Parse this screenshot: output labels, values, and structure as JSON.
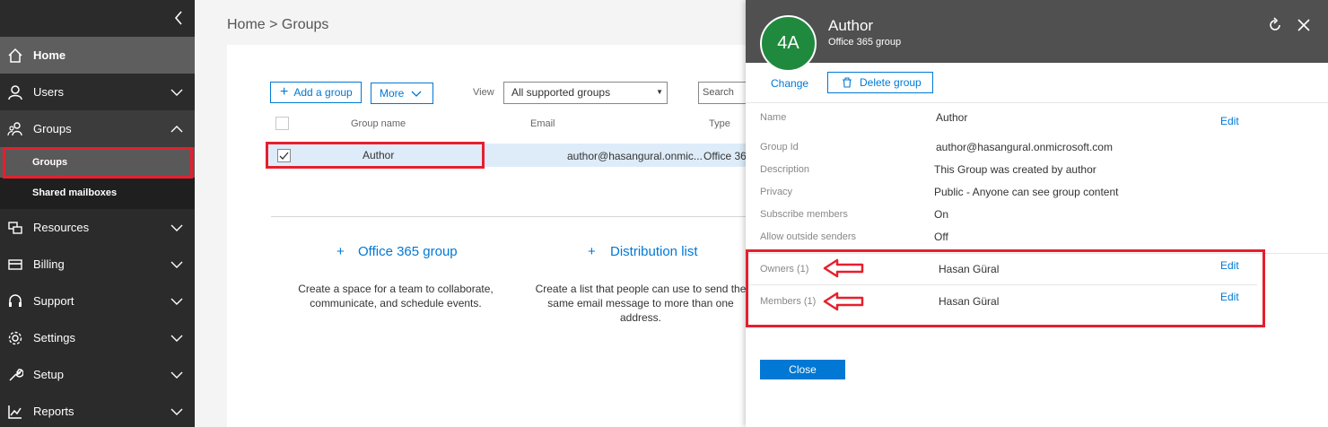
{
  "sidebar": {
    "items": [
      {
        "label": "Home",
        "icon": "home-icon"
      },
      {
        "label": "Users",
        "icon": "user-icon"
      },
      {
        "label": "Groups",
        "icon": "groups-icon"
      },
      {
        "label": "Resources",
        "icon": "resources-icon"
      },
      {
        "label": "Billing",
        "icon": "billing-icon"
      },
      {
        "label": "Support",
        "icon": "headset-icon"
      },
      {
        "label": "Settings",
        "icon": "gear-icon"
      },
      {
        "label": "Setup",
        "icon": "wrench-icon"
      },
      {
        "label": "Reports",
        "icon": "reports-icon"
      }
    ],
    "sub_items": [
      "Groups",
      "Shared mailboxes"
    ]
  },
  "breadcrumb": "Home > Groups",
  "toolbar": {
    "add_group": "Add a group",
    "more": "More",
    "view_label": "View",
    "view_value": "All supported groups",
    "search_placeholder": "Search"
  },
  "table": {
    "headers": [
      "Group name",
      "Email",
      "Type"
    ],
    "rows": [
      {
        "name": "Author",
        "email": "author@hasangural.onmic...",
        "type": "Office 36"
      }
    ]
  },
  "create_options": [
    {
      "title": "Office 365 group",
      "desc_lines": [
        "Create a space for a team to collaborate,",
        "communicate, and schedule events."
      ]
    },
    {
      "title": "Distribution list",
      "desc_lines": [
        "Create a list that people can use to send the",
        "same email message to more than one",
        "address."
      ]
    }
  ],
  "panel": {
    "avatar": "4A",
    "title": "Author",
    "subtitle": "Office 365 group",
    "change": "Change",
    "delete": "Delete group",
    "fields": [
      {
        "label": "Name",
        "value": "Author"
      },
      {
        "label": "Group Id",
        "value": "author@hasangural.onmicrosoft.com"
      },
      {
        "label": "Description",
        "value": "This Group was created by author"
      },
      {
        "label": "Privacy",
        "value": "Public - Anyone can see group content"
      },
      {
        "label": "Subscribe members",
        "value": "On"
      },
      {
        "label": "Allow outside senders",
        "value": "Off"
      }
    ],
    "owners_label": "Owners (1)",
    "owners_value": "Hasan Güral",
    "members_label": "Members (1)",
    "members_value": "Hasan Güral",
    "edit": "Edit",
    "close": "Close"
  },
  "colors": {
    "accent": "#0078d4",
    "highlight": "#e5202e",
    "avatar": "#1f8a3d"
  }
}
